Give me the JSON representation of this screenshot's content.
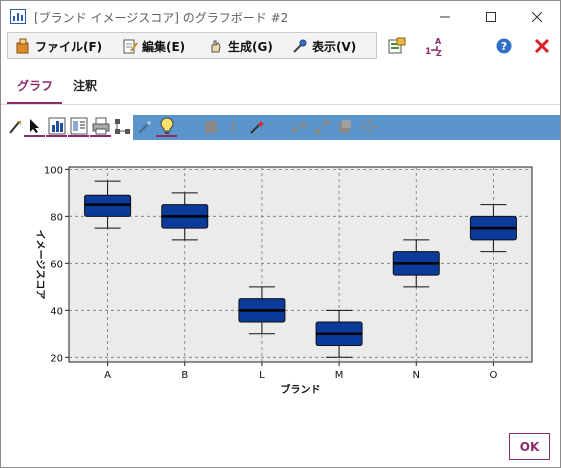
{
  "window": {
    "title": "[ブランド イメージスコア] のグラフボード #2"
  },
  "menu": {
    "items": [
      {
        "label": "ファイル(F)",
        "icon": "file-icon"
      },
      {
        "label": "編集(E)",
        "icon": "edit-icon"
      },
      {
        "label": "生成(G)",
        "icon": "generate-icon"
      },
      {
        "label": "表示(V)",
        "icon": "view-icon"
      }
    ]
  },
  "tabs": [
    {
      "label": "グラフ",
      "selected": true
    },
    {
      "label": "注釈",
      "selected": false
    }
  ],
  "colors": {
    "accent": "#8c2a6a",
    "toolbar_blue": "#5a96cc",
    "box_fill": "#0a3a9a",
    "plot_bg": "#ebebeb"
  },
  "chart_data": {
    "type": "box",
    "xlabel": "ブランド",
    "ylabel": "イメージスコア",
    "ylim": [
      18,
      101
    ],
    "yticks": [
      20,
      40,
      60,
      80,
      100
    ],
    "grid": true,
    "categories": [
      "A",
      "B",
      "L",
      "M",
      "N",
      "O"
    ],
    "boxes": [
      {
        "min": 75,
        "q1": 80,
        "median": 85,
        "q3": 89,
        "max": 95
      },
      {
        "min": 70,
        "q1": 75,
        "median": 80,
        "q3": 85,
        "max": 90
      },
      {
        "min": 30,
        "q1": 35,
        "median": 40,
        "q3": 45,
        "max": 50
      },
      {
        "min": 20,
        "q1": 25,
        "median": 30,
        "q3": 35,
        "max": 40
      },
      {
        "min": 50,
        "q1": 55,
        "median": 60,
        "q3": 65,
        "max": 70
      },
      {
        "min": 65,
        "q1": 70,
        "median": 75,
        "q3": 80,
        "max": 85
      }
    ]
  },
  "footer": {
    "ok_label": "OK"
  }
}
